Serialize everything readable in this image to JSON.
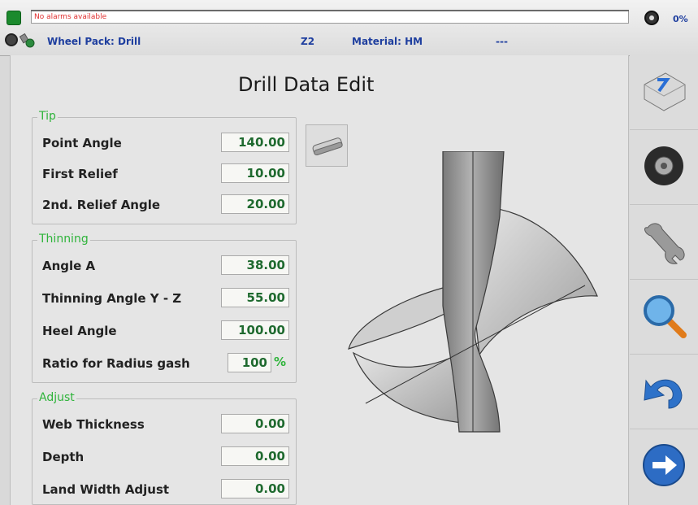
{
  "status": {
    "alarm_text": "No alarms available",
    "progress_pct": "0%",
    "wheel_pack": "Wheel Pack: Drill",
    "z_label": "Z2",
    "material": "Material: HM",
    "extra": "---"
  },
  "page": {
    "title": "Drill Data Edit"
  },
  "tip": {
    "title": "Tip",
    "rows": [
      {
        "label": "Point Angle",
        "value": "140.00"
      },
      {
        "label": "First Relief",
        "value": "10.00"
      },
      {
        "label": "2nd. Relief Angle",
        "value": "20.00"
      }
    ]
  },
  "thinning": {
    "title": "Thinning",
    "rows": [
      {
        "label": "Angle A",
        "value": "38.00"
      },
      {
        "label": "Thinning Angle Y - Z",
        "value": "55.00"
      },
      {
        "label": "Heel Angle",
        "value": "100.00"
      },
      {
        "label": "Ratio for Radius gash",
        "value": "100",
        "unit": "%"
      }
    ]
  },
  "adjust": {
    "title": "Adjust",
    "rows": [
      {
        "label": "Web Thickness",
        "value": "0.00"
      },
      {
        "label": "Depth",
        "value": "0.00"
      },
      {
        "label": "Land Width Adjust",
        "value": "0.00"
      }
    ]
  },
  "toolbar": {
    "buttons": [
      "keyboard-icon",
      "wheel-icon",
      "wrench-icon",
      "magnifier-icon",
      "undo-icon",
      "next-arrow-icon"
    ]
  },
  "colors": {
    "accent_green": "#2fb43b",
    "value_green": "#1f6a2f",
    "info_blue": "#1f3f9f",
    "alarm_red": "#e03030"
  }
}
